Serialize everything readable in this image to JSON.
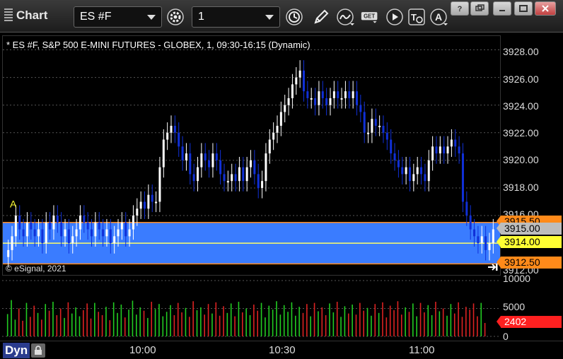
{
  "window": {
    "title": "Chart"
  },
  "toolbar": {
    "symbol": "ES #F",
    "interval": "1"
  },
  "chart": {
    "header": "* ES #F, S&P 500 E-MINI FUTURES - GLOBEX, 1, 09:30-16:15 (Dynamic)",
    "copyright": "© eSignal, 2021",
    "marker_label": "A"
  },
  "price_axis": {
    "ticks": [
      "3928.00",
      "3926.00",
      "3924.00",
      "3922.00",
      "3920.00",
      "3918.00",
      "3916.00",
      "3912.00"
    ],
    "tags": {
      "upper": "3915.50",
      "last": "3915.00",
      "mid": "3914.00",
      "lower": "3912.50"
    }
  },
  "volume_axis": {
    "ticks": [
      "10000",
      "5000",
      "0"
    ],
    "last_volume": "2402"
  },
  "time_axis": {
    "ticks": [
      "10:00",
      "10:30",
      "11:00"
    ],
    "mode_label": "Dyn"
  },
  "colors": {
    "up_bar": "#ffffff",
    "down_bar": "#1030d8",
    "band": "#3a7cff",
    "band_border": "#ff8a1a",
    "midline": "#ffff66",
    "vol_up": "#22cc22",
    "vol_down": "#dd2222",
    "last_tag": "#ff2020"
  },
  "chart_data": {
    "type": "bar",
    "y_range": [
      3911.6,
      3929.0
    ],
    "volume_range": [
      0,
      10000
    ],
    "band": {
      "upper": 3915.5,
      "lower": 3912.5,
      "mid": 3914.0
    },
    "series": [
      {
        "name": "ES #F",
        "values": [
          3913.5,
          3914.5,
          3916.0,
          3915.0,
          3914.5,
          3915.5,
          3915.0,
          3914.5,
          3915.0,
          3914.0,
          3915.5,
          3915.0,
          3916.0,
          3915.5,
          3914.5,
          3915.0,
          3914.0,
          3914.5,
          3915.0,
          3916.0,
          3915.5,
          3915.0,
          3914.5,
          3915.5,
          3915.0,
          3914.5,
          3915.0,
          3914.0,
          3914.5,
          3915.0,
          3915.5,
          3914.5,
          3915.0,
          3916.0,
          3916.5,
          3917.0,
          3916.5,
          3917.5,
          3917.0,
          3917.0,
          3919.5,
          3921.5,
          3922.0,
          3922.5,
          3922.0,
          3921.0,
          3920.0,
          3920.5,
          3919.0,
          3918.5,
          3919.5,
          3920.5,
          3920.0,
          3919.5,
          3920.5,
          3920.0,
          3919.0,
          3918.5,
          3918.5,
          3919.0,
          3918.5,
          3919.5,
          3918.5,
          3919.5,
          3920.0,
          3919.0,
          3918.0,
          3918.5,
          3920.5,
          3921.5,
          3922.0,
          3922.5,
          3923.5,
          3924.0,
          3924.5,
          3925.5,
          3926.0,
          3926.5,
          3925.0,
          3924.5,
          3924.5,
          3924.0,
          3925.0,
          3924.5,
          3924.0,
          3924.5,
          3925.0,
          3924.5,
          3924.5,
          3925.0,
          3924.5,
          3925.0,
          3924.0,
          3923.5,
          3922.0,
          3922.0,
          3923.0,
          3922.5,
          3922.5,
          3922.0,
          3921.5,
          3920.5,
          3920.0,
          3919.5,
          3919.0,
          3919.5,
          3918.5,
          3919.0,
          3919.5,
          3919.0,
          3918.5,
          3920.0,
          3921.0,
          3920.5,
          3921.0,
          3920.5,
          3921.0,
          3921.5,
          3921.0,
          3920.5,
          3917.0,
          3916.0,
          3915.0,
          3914.5,
          3914.0,
          3914.5,
          3913.5,
          3914.0,
          3915.0
        ]
      }
    ],
    "volumes": [
      {
        "name": "up",
        "values": [
          4000,
          6500,
          3000,
          5000,
          2800,
          6000,
          3500,
          5500,
          4200,
          3000,
          5800,
          4600,
          6200,
          3800,
          5000,
          3300,
          6100,
          4100,
          5200,
          3600,
          4700,
          5900,
          3200,
          6000,
          4400,
          3800,
          5300,
          2900,
          6100,
          4200,
          5700,
          3400,
          4800,
          6400,
          3900,
          5200,
          4600,
          3300,
          6200,
          4900,
          5800,
          3600,
          4400,
          5600,
          3800,
          6000,
          4300,
          5100,
          3500,
          6300,
          4700,
          5200,
          3900,
          5800,
          4100,
          6100,
          3700,
          5400,
          4200,
          5900,
          3600,
          6200,
          4300,
          5000,
          3800,
          5700,
          4600,
          6000,
          3400,
          5500,
          4800,
          6300,
          3900,
          5600,
          4400,
          6100,
          3700,
          5300,
          4200,
          5800,
          3600,
          6000,
          4500,
          5200,
          3800,
          5900,
          4300,
          6200,
          3500,
          5400,
          4100,
          5700,
          3900,
          6000,
          4600,
          5100,
          3700,
          5800,
          4200,
          6100,
          3400,
          5500,
          4700,
          6300,
          3900,
          5200,
          4400,
          5900,
          3600,
          6000,
          4300,
          5600,
          3800,
          6200,
          4500,
          5000,
          3700,
          5800,
          4100,
          6100,
          3500,
          5300,
          4800,
          5900,
          3600,
          6000,
          2402
        ]
      }
    ]
  }
}
